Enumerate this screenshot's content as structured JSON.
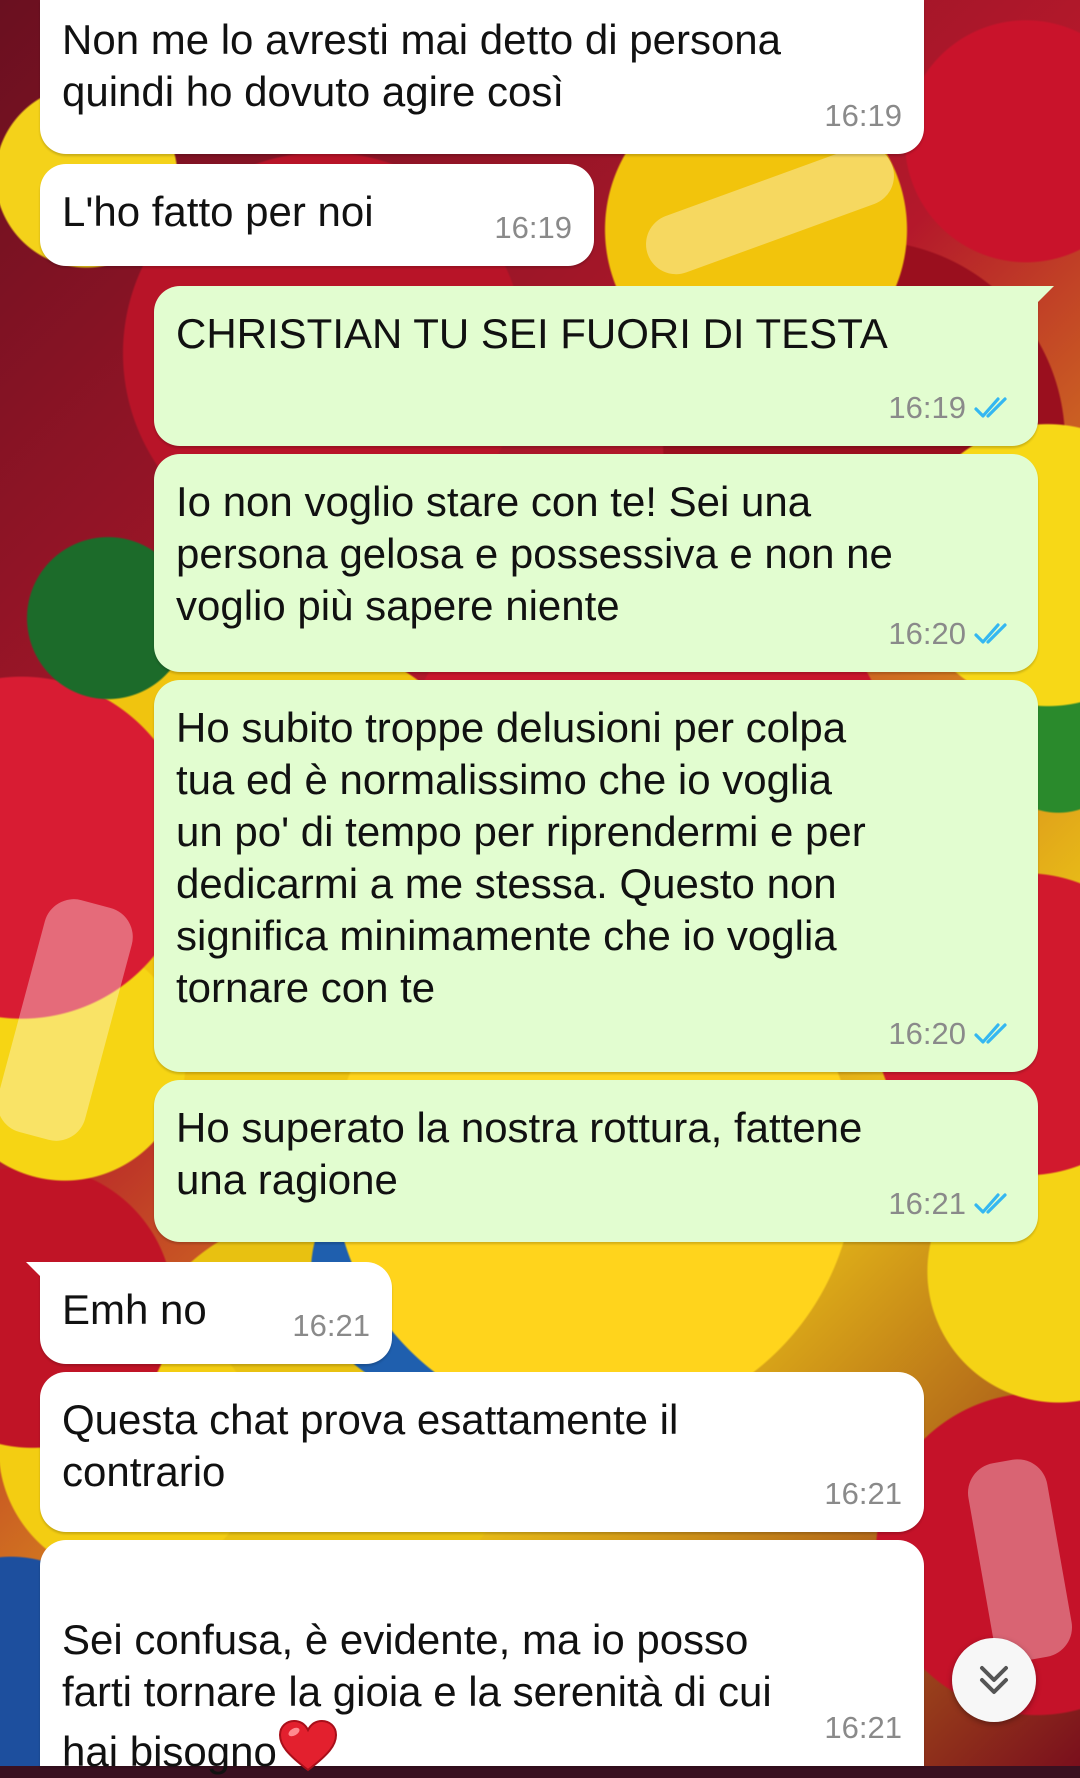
{
  "chat": {
    "messages": [
      {
        "id": "m1",
        "direction": "incoming",
        "text": "Non me lo avresti mai detto di persona\nquindi ho dovuto agire così",
        "time": "16:19"
      },
      {
        "id": "m2",
        "direction": "incoming",
        "text": "L'ho fatto per noi",
        "time": "16:19"
      },
      {
        "id": "m3",
        "direction": "outgoing",
        "text": "CHRISTIAN TU SEI FUORI DI TESTA",
        "time": "16:19",
        "status": "read"
      },
      {
        "id": "m4",
        "direction": "outgoing",
        "text": "Io non voglio stare con te! Sei una\npersona gelosa e possessiva e non ne\nvoglio più sapere niente",
        "time": "16:20",
        "status": "read"
      },
      {
        "id": "m5",
        "direction": "outgoing",
        "text": "Ho subito troppe delusioni per colpa\ntua ed è normalissimo che io voglia\nun po' di tempo per riprendermi e per\ndedicarmi a me stessa. Questo non\nsignifica minimamente che io voglia\ntornare con te",
        "time": "16:20",
        "status": "read"
      },
      {
        "id": "m6",
        "direction": "outgoing",
        "text": "Ho superato la nostra rottura, fattene\nuna ragione",
        "time": "16:21",
        "status": "read"
      },
      {
        "id": "m7",
        "direction": "incoming",
        "text": "Emh no",
        "time": "16:21"
      },
      {
        "id": "m8",
        "direction": "incoming",
        "text": "Questa chat prova esattamente il\ncontrario",
        "time": "16:21"
      },
      {
        "id": "m9",
        "direction": "incoming",
        "text": "Sei confusa, è evidente, ma io posso\nfarti tornare la gioia e la serenità di cui\nhai bisogno",
        "emoji": "red-heart",
        "time": "16:21"
      }
    ],
    "scroll_button_icon": "double-chevron-down-icon"
  },
  "colors": {
    "incoming_bubble": "#ffffff",
    "outgoing_bubble": "#e2fdd0",
    "read_tick": "#34b7f1",
    "timestamp": "#8a8a8a"
  }
}
